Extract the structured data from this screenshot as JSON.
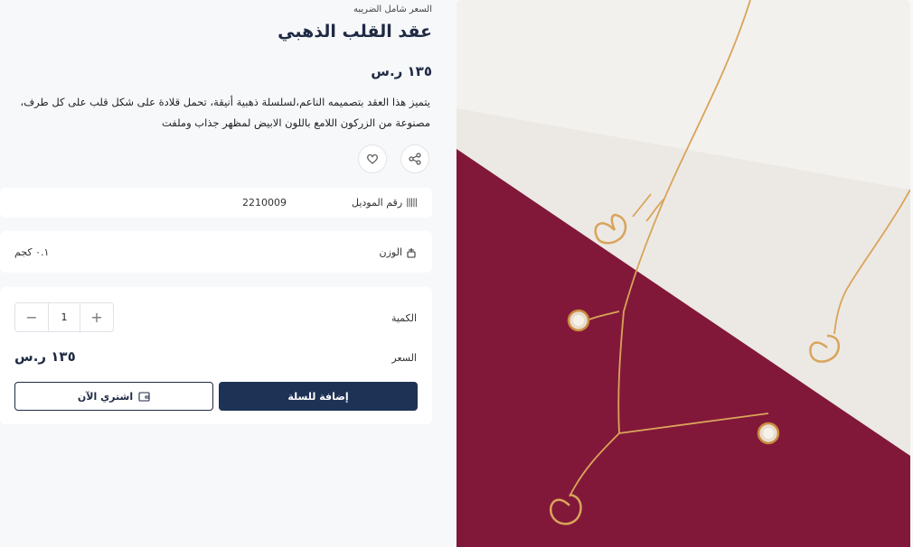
{
  "product": {
    "tax_note": "السعر شامل الضريبه",
    "title": "عقد القلب الذهبي",
    "price": "١٣٥ ر.س",
    "description": "يتميز هذا العقد بتصميمه الناعم،لسلسلة ذهبية أنيقة، تحمل قلادة على شكل قلب على كل طرف، مصنوعة من الزركون اللامع باللون الابيض لمظهر جذاب وملفت"
  },
  "actions": {
    "share_icon": "share-icon",
    "wishlist_icon": "heart-icon"
  },
  "details": {
    "sku_label": "رقم الموديل",
    "sku_value": "2210009",
    "weight_label": "الوزن",
    "weight_value": "٠.١ كجم"
  },
  "purchase": {
    "quantity_label": "الكمية",
    "quantity_value": "1",
    "decrease_symbol": "−",
    "increase_symbol": "+",
    "price_label": "السعر",
    "price_value": "١٣٥ ر.س",
    "add_to_cart": "إضافة للسلة",
    "buy_now": "اشتري الآن"
  },
  "colors": {
    "primary": "#1e3255",
    "fabric_red": "#8a1a3c",
    "fabric_white": "#ece9e4",
    "gold": "#d9a45a"
  }
}
